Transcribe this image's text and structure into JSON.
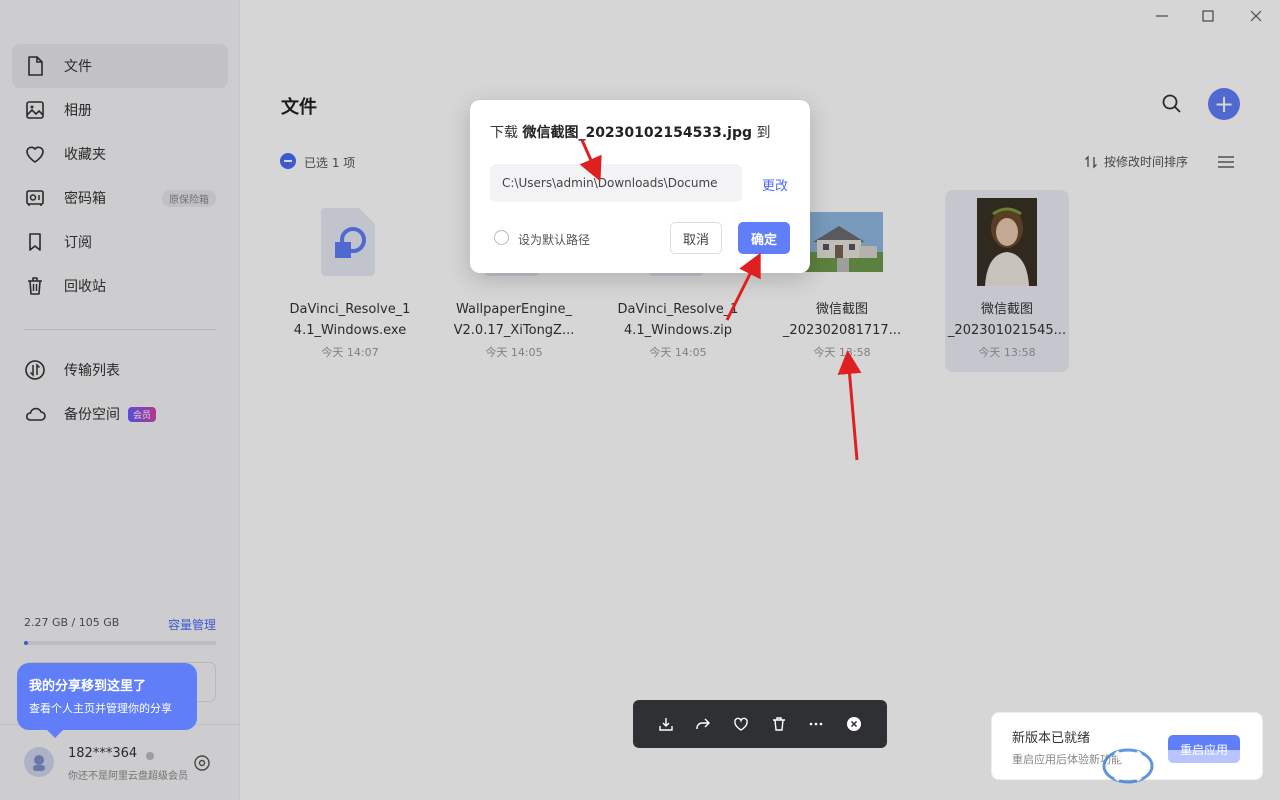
{
  "sidebar": {
    "items": [
      {
        "label": "文件",
        "icon": "file-icon"
      },
      {
        "label": "相册",
        "icon": "photo-icon"
      },
      {
        "label": "收藏夹",
        "icon": "heart-icon"
      },
      {
        "label": "密码箱",
        "icon": "safe-icon",
        "badge": "原保险箱"
      },
      {
        "label": "订阅",
        "icon": "bookmark-icon"
      },
      {
        "label": "回收站",
        "icon": "trash-icon"
      }
    ],
    "transfer": {
      "label": "传输列表"
    },
    "backup": {
      "label": "备份空间",
      "badge": "会员"
    },
    "storage": {
      "text": "2.27 GB / 105 GB",
      "link": "容量管理",
      "used_fraction": 0.022
    },
    "tooltip": {
      "title": "我的分享移到这里了",
      "desc": "查看个人主页并管理你的分享"
    },
    "user": {
      "name": "182***364",
      "sub": "你还不是阿里云盘超级会员"
    }
  },
  "main": {
    "title": "文件",
    "selection": "已选 1 项",
    "sort_label": "按修改时间排序",
    "files": [
      {
        "name_line1": "DaVinci_Resolve_1",
        "name_line2": "4.1_Windows.exe",
        "date": "今天 14:07",
        "type": "exe"
      },
      {
        "name_line1": "WallpaperEngine_",
        "name_line2": "V2.0.17_XiTongZ...",
        "date": "今天 14:05",
        "type": "zip"
      },
      {
        "name_line1": "DaVinci_Resolve_1",
        "name_line2": "4.1_Windows.zip",
        "date": "今天 14:05",
        "type": "zip"
      },
      {
        "name_line1": "微信截图",
        "name_line2": "_202302081717...",
        "date": "今天 13:58",
        "type": "image-house"
      },
      {
        "name_line1": "微信截图",
        "name_line2": "_202301021545...",
        "date": "今天 13:58",
        "type": "image-portrait",
        "selected": true
      }
    ]
  },
  "dialog": {
    "title_prefix": "下载 ",
    "filename": "微信截图_20230102154533.jpg",
    "title_suffix": "到",
    "path": "C:\\Users\\admin\\Downloads\\Docume",
    "change_label": "更改",
    "default_label": "设为默认路径",
    "cancel_label": "取消",
    "ok_label": "确定"
  },
  "update": {
    "title": "新版本已就绪",
    "sub": "重启应用后体验新功能",
    "button": "重启应用"
  },
  "colors": {
    "accent": "#5f7ef8",
    "arrow": "#e02020"
  }
}
